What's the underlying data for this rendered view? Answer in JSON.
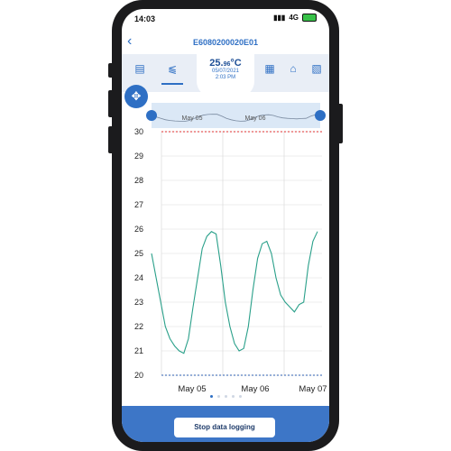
{
  "status_bar": {
    "time": "14:03",
    "network": "4G",
    "signal_icon": "signal-bars-icon",
    "battery_icon": "battery-charging-icon"
  },
  "header": {
    "device_id": "E6080200020E01",
    "back_icon": "chevron-left-icon"
  },
  "reading": {
    "temp_main": "25.",
    "temp_decimals": "96",
    "temp_unit": "°C",
    "date": "05/07/2021",
    "time": "2:03 PM"
  },
  "toolbar": {
    "icons": [
      "clipboard-icon",
      "chart-icon",
      "calendar-icon",
      "map-icon",
      "document-icon"
    ],
    "active": "chart-icon"
  },
  "navigator": {
    "labels": [
      "May 05",
      "May 06"
    ]
  },
  "chart_data": {
    "type": "line",
    "ylim": [
      20,
      30
    ],
    "yticks": [
      "20",
      "21",
      "22",
      "23",
      "24",
      "25",
      "26",
      "27",
      "28",
      "29",
      "30"
    ],
    "xticks": [
      "May 05",
      "May 06",
      "May 07"
    ],
    "upper_limit": 30,
    "lower_limit": 20,
    "series": [
      {
        "values": [
          25.0,
          24.0,
          23.0,
          22.0,
          21.5,
          21.2,
          21.0,
          20.9,
          21.5,
          22.8,
          24.0,
          25.2,
          25.7,
          25.9,
          25.8,
          24.5,
          23.0,
          22.0,
          21.3,
          21.0,
          21.1,
          22.0,
          23.5,
          24.8,
          25.4,
          25.5,
          25.0,
          24.0,
          23.3,
          23.0,
          22.8,
          22.6,
          22.9,
          23.0,
          24.5,
          25.5,
          25.9
        ]
      }
    ],
    "colors": {
      "line": "#2aa08a",
      "upper": "#e03030",
      "lower": "#2e5fb0",
      "grid": "#d9d9d9"
    }
  },
  "pager": {
    "count": 5,
    "active": 0
  },
  "actions": {
    "stop_label": "Stop data logging"
  }
}
